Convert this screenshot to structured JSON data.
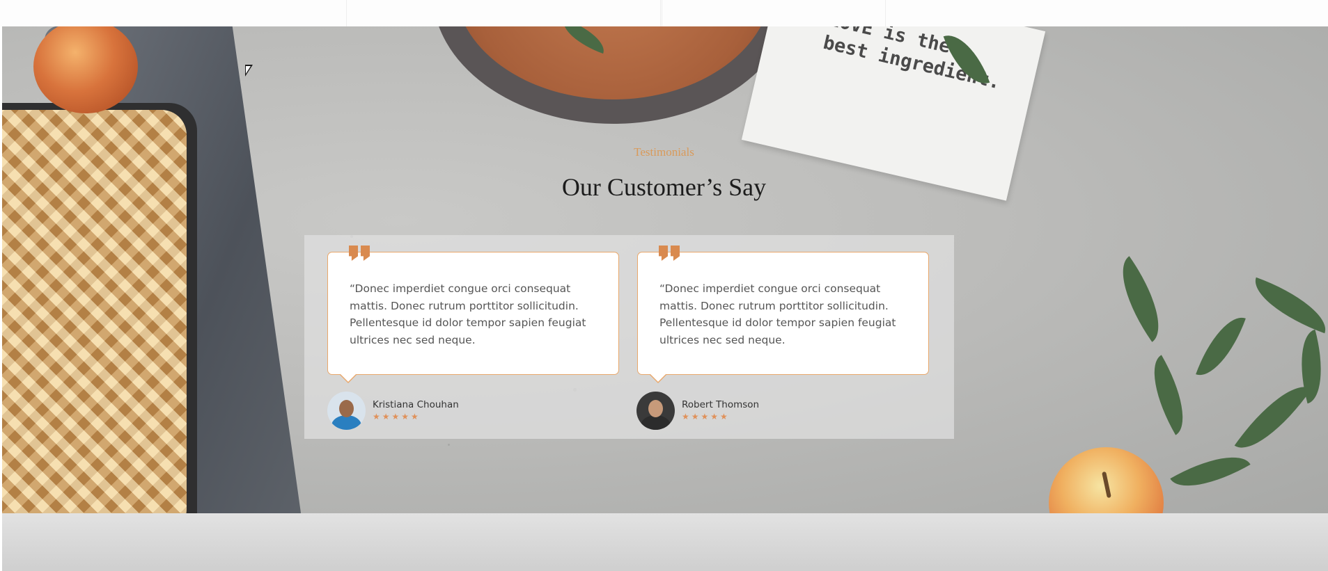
{
  "section": {
    "eyebrow": "Testimonials",
    "title": "Our Customer’s Say"
  },
  "decor": {
    "napkin_text": "LOVE is the\nbest ingredient."
  },
  "testimonials": [
    {
      "quote": "“Donec imperdiet congue orci consequat mattis. Donec rutrum porttitor sollicitudin. Pellentesque id dolor tempor sapien feugiat ultrices nec sed neque.",
      "author": "Kristiana Chouhan",
      "rating": 5,
      "stars": "★★★★★",
      "avatar_icon": "woman-avatar"
    },
    {
      "quote": "“Donec imperdiet congue orci consequat mattis. Donec rutrum porttitor sollicitudin. Pellentesque id dolor tempor sapien feugiat ultrices nec sed neque.",
      "author": "Robert Thomson",
      "rating": 5,
      "stars": "★★★★★",
      "avatar_icon": "man-avatar"
    }
  ],
  "colors": {
    "accent": "#d98a4f",
    "card_border": "#e9a76a",
    "heading": "#1c1c1c"
  }
}
